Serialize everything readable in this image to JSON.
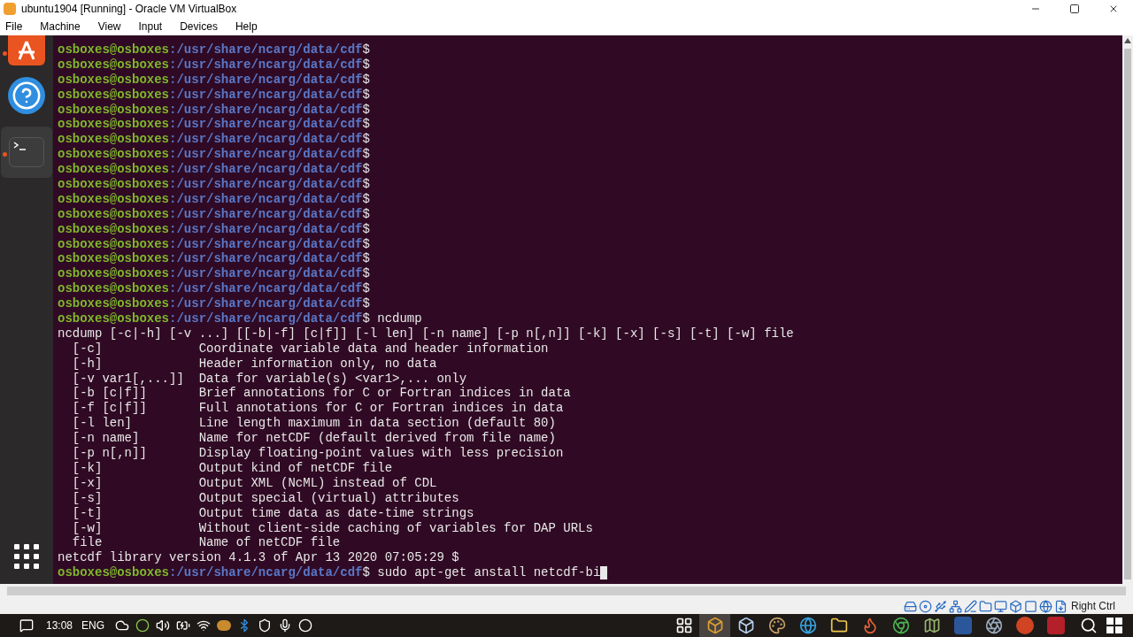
{
  "window": {
    "title": "ubuntu1904 [Running] - Oracle VM VirtualBox"
  },
  "menu": [
    "File",
    "Machine",
    "View",
    "Input",
    "Devices",
    "Help"
  ],
  "dock": [
    {
      "kind": "software",
      "running": true,
      "selected": false
    },
    {
      "kind": "help",
      "running": false,
      "selected": false
    },
    {
      "kind": "terminal",
      "running": true,
      "selected": true
    }
  ],
  "terminal": {
    "lines": [
      {
        "kind": "prompt",
        "user": "osboxes@osboxes",
        "path": ":/usr/share/ncarg/data/cdf",
        "sign": "$"
      },
      {
        "kind": "prompt",
        "user": "osboxes@osboxes",
        "path": ":/usr/share/ncarg/data/cdf",
        "sign": "$"
      },
      {
        "kind": "prompt",
        "user": "osboxes@osboxes",
        "path": ":/usr/share/ncarg/data/cdf",
        "sign": "$"
      },
      {
        "kind": "prompt",
        "user": "osboxes@osboxes",
        "path": ":/usr/share/ncarg/data/cdf",
        "sign": "$"
      },
      {
        "kind": "prompt",
        "user": "osboxes@osboxes",
        "path": ":/usr/share/ncarg/data/cdf",
        "sign": "$"
      },
      {
        "kind": "prompt",
        "user": "osboxes@osboxes",
        "path": ":/usr/share/ncarg/data/cdf",
        "sign": "$"
      },
      {
        "kind": "prompt",
        "user": "osboxes@osboxes",
        "path": ":/usr/share/ncarg/data/cdf",
        "sign": "$"
      },
      {
        "kind": "prompt",
        "user": "osboxes@osboxes",
        "path": ":/usr/share/ncarg/data/cdf",
        "sign": "$"
      },
      {
        "kind": "prompt",
        "user": "osboxes@osboxes",
        "path": ":/usr/share/ncarg/data/cdf",
        "sign": "$"
      },
      {
        "kind": "prompt",
        "user": "osboxes@osboxes",
        "path": ":/usr/share/ncarg/data/cdf",
        "sign": "$"
      },
      {
        "kind": "prompt",
        "user": "osboxes@osboxes",
        "path": ":/usr/share/ncarg/data/cdf",
        "sign": "$"
      },
      {
        "kind": "prompt",
        "user": "osboxes@osboxes",
        "path": ":/usr/share/ncarg/data/cdf",
        "sign": "$"
      },
      {
        "kind": "prompt",
        "user": "osboxes@osboxes",
        "path": ":/usr/share/ncarg/data/cdf",
        "sign": "$"
      },
      {
        "kind": "prompt",
        "user": "osboxes@osboxes",
        "path": ":/usr/share/ncarg/data/cdf",
        "sign": "$"
      },
      {
        "kind": "prompt",
        "user": "osboxes@osboxes",
        "path": ":/usr/share/ncarg/data/cdf",
        "sign": "$"
      },
      {
        "kind": "prompt",
        "user": "osboxes@osboxes",
        "path": ":/usr/share/ncarg/data/cdf",
        "sign": "$"
      },
      {
        "kind": "prompt",
        "user": "osboxes@osboxes",
        "path": ":/usr/share/ncarg/data/cdf",
        "sign": "$"
      },
      {
        "kind": "prompt",
        "user": "osboxes@osboxes",
        "path": ":/usr/share/ncarg/data/cdf",
        "sign": "$"
      },
      {
        "kind": "prompt",
        "user": "osboxes@osboxes",
        "path": ":/usr/share/ncarg/data/cdf",
        "sign": "$",
        "command": "ncdump"
      },
      {
        "kind": "output",
        "text": "ncdump [-c|-h] [-v ...] [[-b|-f] [c|f]] [-l len] [-n name] [-p n[,n]] [-k] [-x] [-s] [-t] [-w] file"
      },
      {
        "kind": "output",
        "text": "  [-c]             Coordinate variable data and header information"
      },
      {
        "kind": "output",
        "text": "  [-h]             Header information only, no data"
      },
      {
        "kind": "output",
        "text": "  [-v var1[,...]]  Data for variable(s) <var1>,... only"
      },
      {
        "kind": "output",
        "text": "  [-b [c|f]]       Brief annotations for C or Fortran indices in data"
      },
      {
        "kind": "output",
        "text": "  [-f [c|f]]       Full annotations for C or Fortran indices in data"
      },
      {
        "kind": "output",
        "text": "  [-l len]         Line length maximum in data section (default 80)"
      },
      {
        "kind": "output",
        "text": "  [-n name]        Name for netCDF (default derived from file name)"
      },
      {
        "kind": "output",
        "text": "  [-p n[,n]]       Display floating-point values with less precision"
      },
      {
        "kind": "output",
        "text": "  [-k]             Output kind of netCDF file"
      },
      {
        "kind": "output",
        "text": "  [-x]             Output XML (NcML) instead of CDL"
      },
      {
        "kind": "output",
        "text": "  [-s]             Output special (virtual) attributes"
      },
      {
        "kind": "output",
        "text": "  [-t]             Output time data as date-time strings"
      },
      {
        "kind": "output",
        "text": "  [-w]             Without client-side caching of variables for DAP URLs"
      },
      {
        "kind": "output",
        "text": "  file             Name of netCDF file"
      },
      {
        "kind": "output",
        "text": "netcdf library version 4.1.3 of Apr 13 2020 07:05:29 $"
      },
      {
        "kind": "prompt",
        "user": "osboxes@osboxes",
        "path": ":/usr/share/ncarg/data/cdf",
        "sign": "$",
        "command": "sudo apt-get anstall netcdf-bi",
        "cursor": true
      }
    ]
  },
  "status_bar": {
    "host_key": "Right Ctrl"
  },
  "taskbar": {
    "time": "13:08",
    "language": "ENG",
    "apps": [
      {
        "selected": false
      },
      {
        "selected": true
      },
      {
        "selected": false
      },
      {
        "selected": false
      },
      {
        "selected": false
      },
      {
        "selected": false
      },
      {
        "selected": false
      },
      {
        "selected": false
      },
      {
        "selected": false
      },
      {
        "selected": false
      },
      {
        "selected": false
      },
      {
        "selected": false
      },
      {
        "selected": false
      }
    ]
  }
}
